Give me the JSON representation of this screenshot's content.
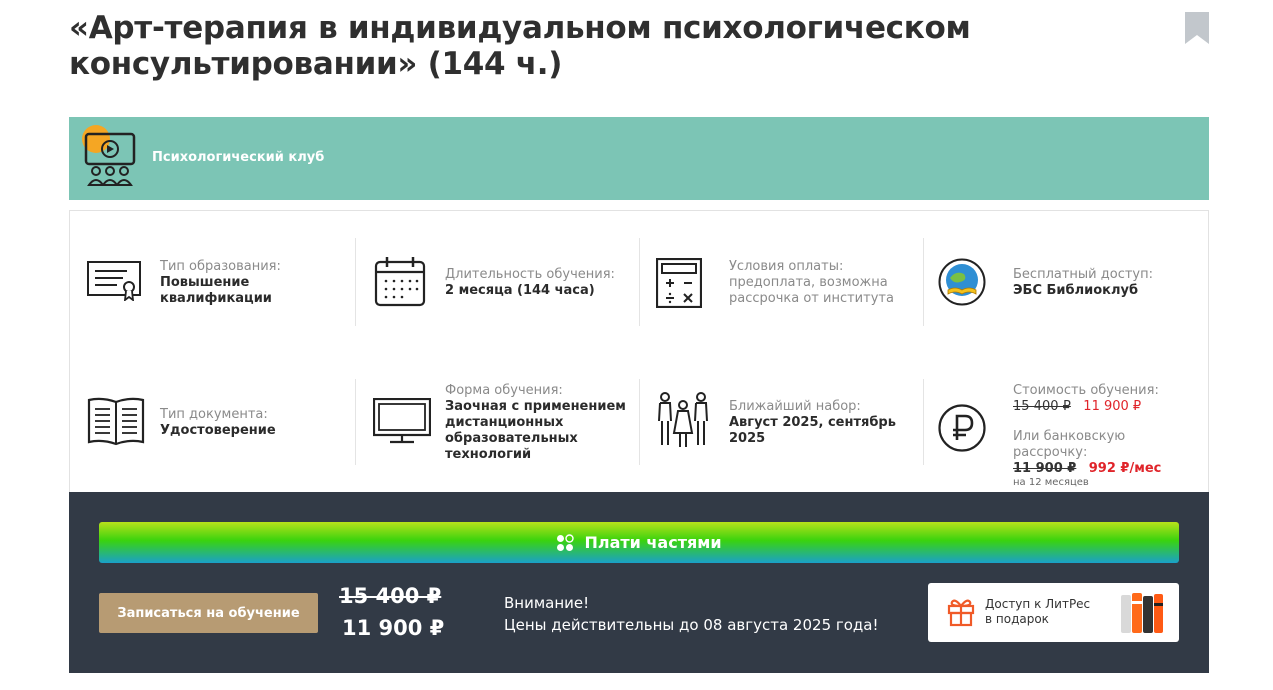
{
  "page": {
    "title": "«Арт-терапия в индивидуальном психологическом консультировании» (144 ч.)"
  },
  "club": {
    "label": "Психологический клуб"
  },
  "info": {
    "education_type": {
      "label": "Тип образования:",
      "value": "Повышение квалификации"
    },
    "duration": {
      "label": "Длительность обучения:",
      "value": "2 месяца (144 часа)"
    },
    "payment_terms": {
      "label": "Условия оплаты:",
      "value": "предоплата, возможна рассрочка от института"
    },
    "free_access": {
      "label": "Бесплатный доступ:",
      "value": "ЭБС Библиоклуб"
    },
    "document_type": {
      "label": "Тип документа:",
      "value": "Удостоверение"
    },
    "study_form": {
      "label": "Форма обучения:",
      "value": "Заочная с применением дистанционных образовательных технологий"
    },
    "next_intake": {
      "label": "Ближайший набор:",
      "value": "Август 2025, сентябрь 2025"
    },
    "cost": {
      "label": "Стоимость обучения:",
      "old_price": "15 400 ₽",
      "new_price": "11 900 ₽",
      "installment_label": "Или банковскую рассрочку:",
      "installment_old": "11 900 ₽",
      "installment_new": "992 ₽/мес",
      "installment_period": "на 12 месяцев"
    }
  },
  "cta": {
    "pay_parts_label": "Плати частями",
    "enroll_label": "Записаться на обучение",
    "old_price": "15 400 ₽",
    "new_price": "11 900 ₽",
    "notice_title": "Внимание!",
    "notice_text": "Цены действительны до 08 августа 2025 года!",
    "litres_line1": "Доступ к ЛитРес",
    "litres_line2": "в подарок"
  },
  "colors": {
    "club_band": "#7cc5b5",
    "dark_panel": "#323a46",
    "enroll_button": "#b79b73",
    "price_red": "#e0242a",
    "gift_orange": "#f05a28"
  },
  "icons": [
    "bookmark-icon",
    "video-group-icon",
    "certificate-icon",
    "calendar-icon",
    "calculator-icon",
    "library-globe-icon",
    "open-book-icon",
    "monitor-icon",
    "family-icon",
    "ruble-icon",
    "pay-parts-dots-icon",
    "gift-icon",
    "books-icon"
  ]
}
